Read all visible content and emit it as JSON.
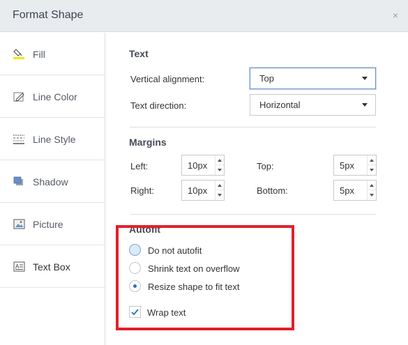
{
  "window": {
    "title": "Format Shape",
    "close_glyph": "×"
  },
  "sidebar": {
    "items": [
      {
        "label": "Fill",
        "icon": "paint-bucket-icon"
      },
      {
        "label": "Line Color",
        "icon": "pencil-icon"
      },
      {
        "label": "Line Style",
        "icon": "line-style-icon"
      },
      {
        "label": "Shadow",
        "icon": "shadow-icon"
      },
      {
        "label": "Picture",
        "icon": "picture-icon"
      },
      {
        "label": "Text Box",
        "icon": "text-box-icon"
      }
    ],
    "active": "Text Box"
  },
  "text_section": {
    "title": "Text",
    "vertical_alignment_label": "Vertical alignment:",
    "vertical_alignment_value": "Top",
    "text_direction_label": "Text direction:",
    "text_direction_value": "Horizontal"
  },
  "margins_section": {
    "title": "Margins",
    "left_label": "Left:",
    "left_value": "10px",
    "top_label": "Top:",
    "top_value": "5px",
    "right_label": "Right:",
    "right_value": "10px",
    "bottom_label": "Bottom:",
    "bottom_value": "5px"
  },
  "autofit_section": {
    "title": "Autofit",
    "options": [
      {
        "label": "Do not autofit",
        "checked": false,
        "hovered": true
      },
      {
        "label": "Shrink text on overflow",
        "checked": false,
        "hovered": false
      },
      {
        "label": "Resize shape to fit text",
        "checked": true,
        "hovered": false
      }
    ],
    "wrap_text_label": "Wrap text",
    "wrap_text_checked": true
  },
  "colors": {
    "highlight_border": "#e3202a",
    "accent": "#2b6fbf",
    "fill_icon_yellow": "#f2e600"
  }
}
